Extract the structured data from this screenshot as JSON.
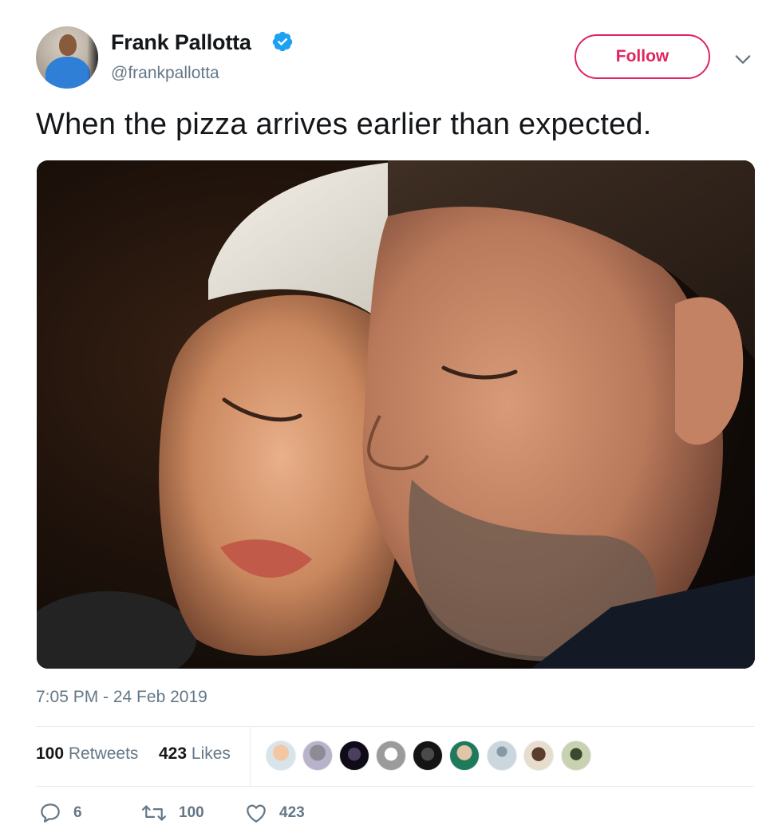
{
  "author": {
    "name": "Frank Pallotta",
    "handle": "@frankpallotta",
    "verified": true
  },
  "header": {
    "follow_label": "Follow",
    "menu_icon": "chevron-down-icon"
  },
  "tweet": {
    "text": "When the pizza arrives earlier than expected.",
    "media": "photo: two performers with eyes closed, heads together, singing at a microphone",
    "timestamp": "7:05 PM - 24 Feb 2019"
  },
  "stats": {
    "retweets_count": "100",
    "retweets_label": "Retweets",
    "likes_count": "423",
    "likes_label": "Likes",
    "likers": [
      "avatar-1",
      "avatar-2",
      "avatar-3",
      "avatar-4",
      "avatar-5",
      "avatar-6",
      "avatar-7",
      "avatar-8",
      "avatar-9"
    ]
  },
  "actions": {
    "replies": "6",
    "retweets": "100",
    "likes": "423"
  },
  "colors": {
    "accent": "#e0245e",
    "verified": "#1da1f2",
    "secondary_text": "#657786",
    "primary_text": "#14171a"
  }
}
